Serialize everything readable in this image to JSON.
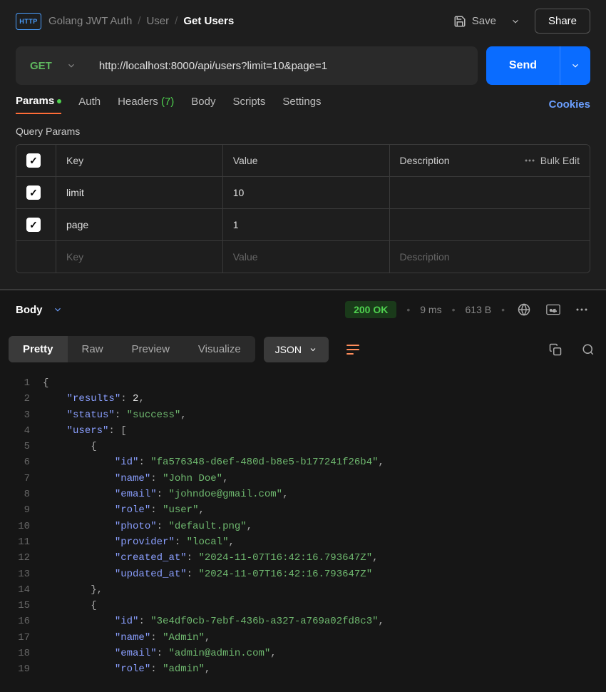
{
  "breadcrumb": {
    "collection": "Golang JWT Auth",
    "folder": "User",
    "request": "Get Users"
  },
  "topbar": {
    "save": "Save",
    "share": "Share"
  },
  "request": {
    "method": "GET",
    "url": "http://localhost:8000/api/users?limit=10&page=1",
    "send": "Send"
  },
  "tabs": {
    "params": "Params",
    "auth": "Auth",
    "headers": "Headers",
    "headers_count": "(7)",
    "body": "Body",
    "scripts": "Scripts",
    "settings": "Settings",
    "cookies": "Cookies"
  },
  "params_section": {
    "title": "Query Params",
    "head_key": "Key",
    "head_value": "Value",
    "head_desc": "Description",
    "bulk": "Bulk Edit",
    "rows": [
      {
        "key": "limit",
        "value": "10"
      },
      {
        "key": "page",
        "value": "1"
      }
    ],
    "ph_key": "Key",
    "ph_value": "Value",
    "ph_desc": "Description"
  },
  "response": {
    "body_label": "Body",
    "status": "200 OK",
    "time": "9 ms",
    "size": "613 B",
    "tabs": {
      "pretty": "Pretty",
      "raw": "Raw",
      "preview": "Preview",
      "visualize": "Visualize"
    },
    "format": "JSON",
    "json_lines": [
      "{",
      "    \"results\": 2,",
      "    \"status\": \"success\",",
      "    \"users\": [",
      "        {",
      "            \"id\": \"fa576348-d6ef-480d-b8e5-b177241f26b4\",",
      "            \"name\": \"John Doe\",",
      "            \"email\": \"johndoe@gmail.com\",",
      "            \"role\": \"user\",",
      "            \"photo\": \"default.png\",",
      "            \"provider\": \"local\",",
      "            \"created_at\": \"2024-11-07T16:42:16.793647Z\",",
      "            \"updated_at\": \"2024-11-07T16:42:16.793647Z\"",
      "        },",
      "        {",
      "            \"id\": \"3e4df0cb-7ebf-436b-a327-a769a02fd8c3\",",
      "            \"name\": \"Admin\",",
      "            \"email\": \"admin@admin.com\",",
      "            \"role\": \"admin\","
    ]
  }
}
